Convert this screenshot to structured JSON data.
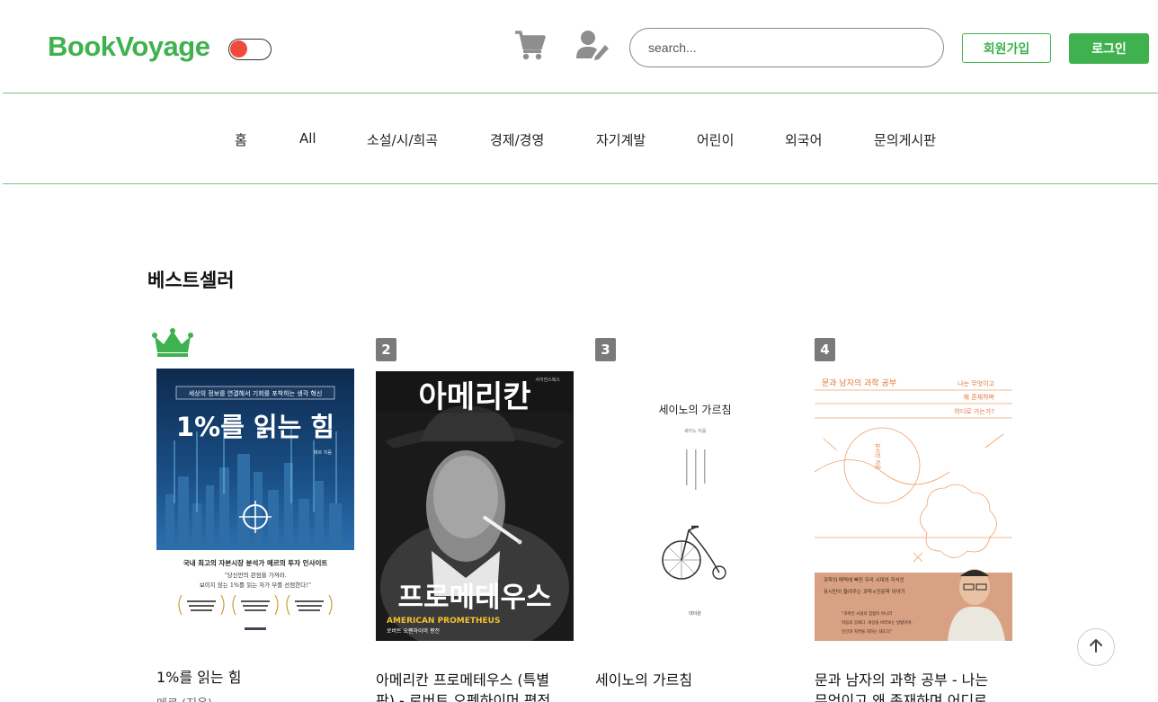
{
  "header": {
    "logo": "BookVoyage",
    "search_placeholder": "search...",
    "signup_label": "회원가입",
    "login_label": "로그인",
    "brand_color": "#3fb24f",
    "toggle_color": "#ef4b3a"
  },
  "nav": {
    "items": [
      "홈",
      "All",
      "소설/시/희곡",
      "경제/경영",
      "자기계발",
      "어린이",
      "외국어",
      "문의게시판"
    ]
  },
  "section": {
    "title": "베스트셀러"
  },
  "books": [
    {
      "rank": "1",
      "title": "1%를 읽는 힘",
      "subtitle": "메르 (지음)",
      "cover": {
        "top_text": "세상의 정보를 연결해서 기회를 포착하는 생각 혁신",
        "big_text": "1%를 읽는 힘",
        "author_small": "메르 지음",
        "line1": "국내 최고의 자본시장 분석가 메르의 투자 인사이트",
        "line2": "“당신만의 관점을 가져라.",
        "line3": "보이지 않는 1%를 읽는 자가 부를 선점한다!”"
      }
    },
    {
      "rank": "2",
      "title_line1": "아메리칸 프로메테우스 (특별",
      "title_line2": "판) - 로버트 오펜하이머 평전",
      "cover": {
        "publisher": "사이언스북스",
        "top_text": "아메리칸",
        "bottom_text": "프로메테우스",
        "en_text": "AMERICAN PROMETHEUS",
        "sub_text": "로버트 오펜하이머 평전"
      }
    },
    {
      "rank": "3",
      "title": "세이노의 가르침",
      "cover": {
        "title": "세이노의 가르침",
        "author": "세이노 지음",
        "publisher": "데이원"
      }
    },
    {
      "rank": "4",
      "title_line1": "문과 남자의 과학 공부 - 나는",
      "title_line2": "무엇이고 왜 존재하며 어디로",
      "cover": {
        "title": "문과 남자의 과학 공부",
        "right1": "나는 무엇이고",
        "right2": "왜 존재하며",
        "right3": "어디로 가는가?",
        "author_vertical": "유시민 지음",
        "b1": "과학의 매력에 빠진 우리 시대의 지식인",
        "b2": "유시민이 들려주는 과학×인문학 이야기",
        "b3": "“과학은 사실의 집합이 아니라",
        "b4": "마음의 상태다. 세상을 바라보는 방법이며,",
        "b5": "인간과 자연을 대하는 태도다”"
      }
    }
  ]
}
